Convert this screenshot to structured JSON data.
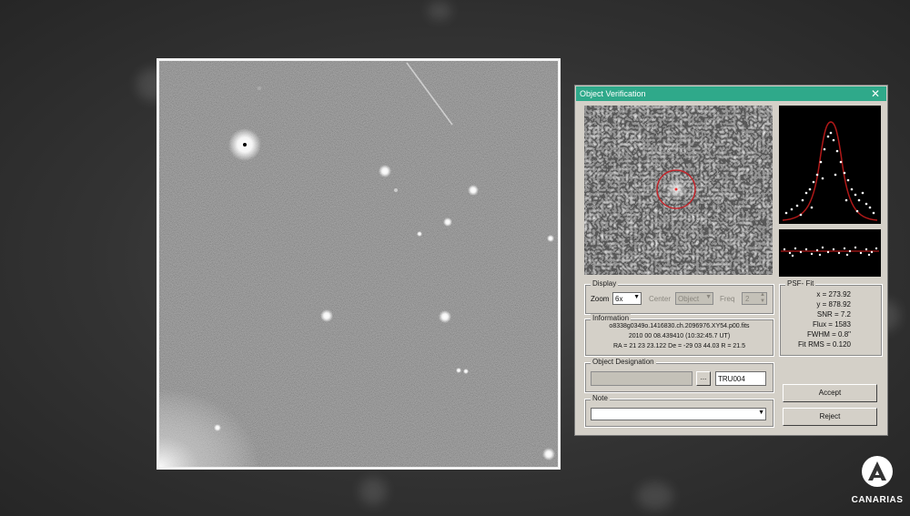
{
  "dialog": {
    "title": "Object Verification",
    "close_symbol": "✕",
    "display": {
      "legend": "Display",
      "zoom_label": "Zoom",
      "zoom_value": "6x",
      "center_label": "Center",
      "center_value": "Object",
      "freq_label": "Freq",
      "freq_value": "2"
    },
    "information": {
      "legend": "Information",
      "line1": "o8338g0349o.1416830.ch.2096976.XY54.p00.fits",
      "line2": "2010 00 08.439410 (10:32:45.7 UT)",
      "line3": "RA = 21 23 23.122   De = -29 03 44.03   R = 21.5"
    },
    "designation": {
      "legend": "Object Designation",
      "browse_label": "...",
      "value": "TRU004"
    },
    "note": {
      "legend": "Note",
      "value": ""
    },
    "psf_fit": {
      "legend": "PSF- Fit",
      "lines": [
        "x = 273.92",
        "y = 878.92",
        "SNR = 7.2",
        "Flux = 1583",
        "FWHM = 0.8\"",
        "Fit RMS = 0.120"
      ]
    },
    "accept_label": "Accept",
    "reject_label": "Reject"
  },
  "watermark": {
    "icon": "antena3-logo-icon",
    "text": "CANARIAS"
  }
}
